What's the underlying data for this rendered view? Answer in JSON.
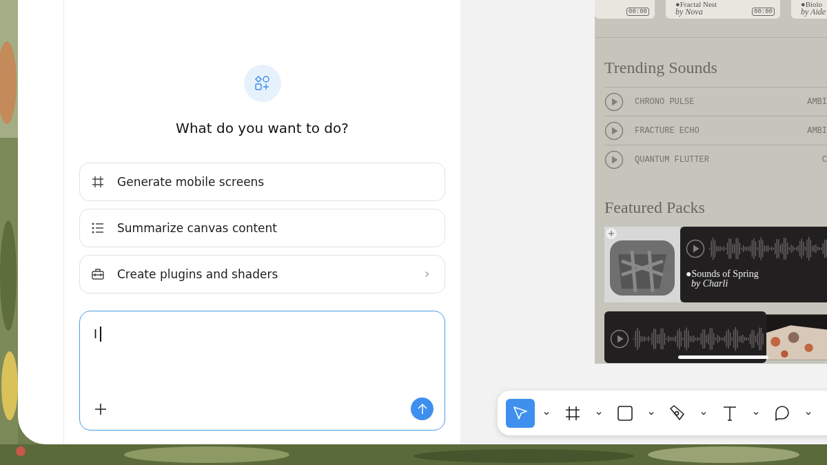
{
  "assistant": {
    "title": "What do you want to do?",
    "options": [
      {
        "label": "Generate mobile screens",
        "kind": "frame",
        "submenu": false
      },
      {
        "label": "Summarize canvas content",
        "kind": "list",
        "submenu": false
      },
      {
        "label": "Create plugins and shaders",
        "kind": "toolbox",
        "submenu": true
      }
    ],
    "prompt": {
      "value": "I"
    }
  },
  "canvas": {
    "top_cards": [
      {
        "duration": "00:00"
      },
      {
        "title": "●Fractal Nest",
        "author": "by Nova",
        "duration": "00:00"
      },
      {
        "title": "●Biolo",
        "author": "by Aide"
      }
    ],
    "trending": {
      "title": "Trending Sounds",
      "rows": [
        {
          "name": "CHRONO PULSE",
          "genre": "AMBI"
        },
        {
          "name": "FRACTURE ECHO",
          "genre": "AMBI"
        },
        {
          "name": "QUANTUM FLUTTER",
          "genre": "C"
        }
      ]
    },
    "featured": {
      "title": "Featured Packs",
      "pack": {
        "title": "●Sounds of Spring",
        "author": "by Charli"
      }
    }
  },
  "toolbar": [
    {
      "kind": "select",
      "selected": true
    },
    {
      "kind": "frame",
      "selected": false
    },
    {
      "kind": "rectangle",
      "selected": false
    },
    {
      "kind": "pen",
      "selected": false
    },
    {
      "kind": "text",
      "selected": false
    },
    {
      "kind": "comment",
      "selected": false
    }
  ]
}
